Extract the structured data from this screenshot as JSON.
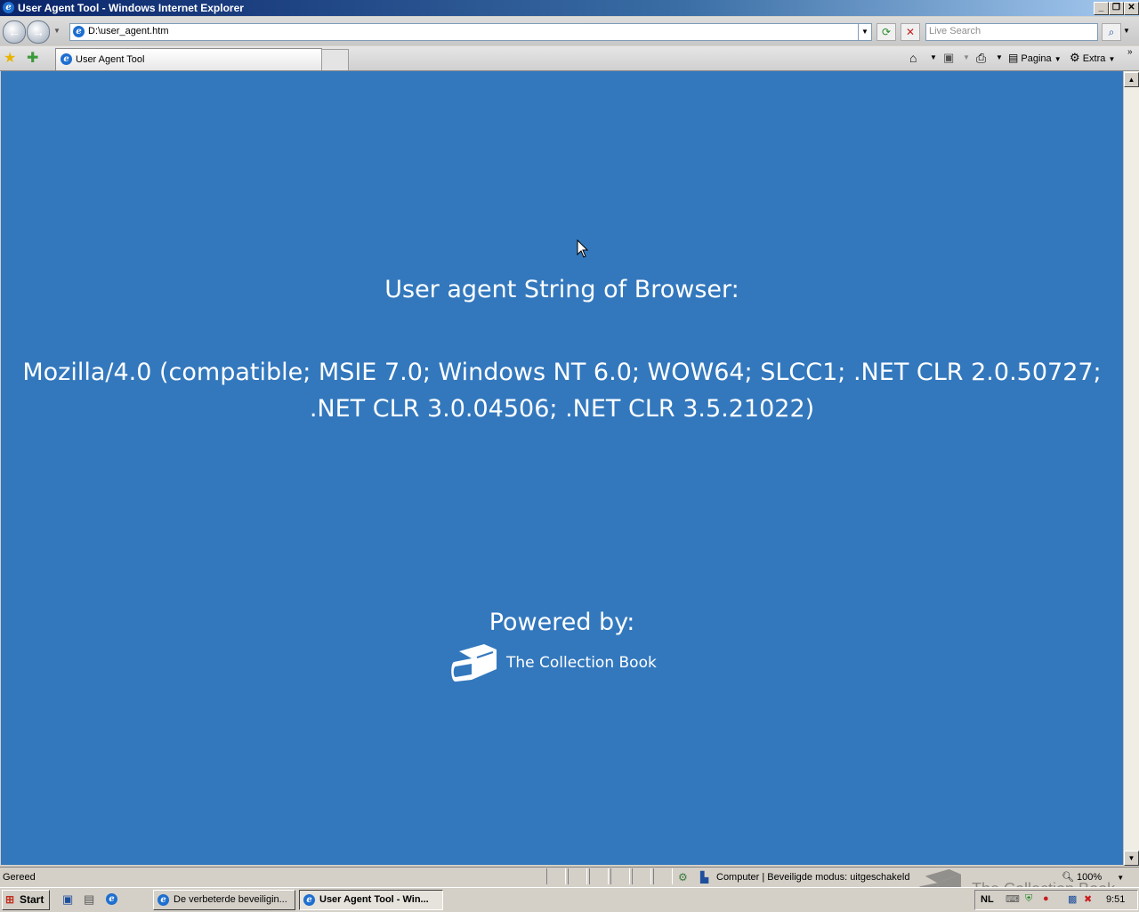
{
  "window": {
    "title": "User Agent Tool - Windows Internet Explorer",
    "minimize": "_",
    "restore": "❐",
    "close": "✕"
  },
  "addressbar": {
    "url": "D:\\user_agent.htm",
    "search_placeholder": "Live Search"
  },
  "tabs": [
    {
      "label": "User Agent Tool"
    }
  ],
  "toolbar": {
    "page_label": "Pagina",
    "tools_label": "Extra"
  },
  "page": {
    "heading": "User agent String of Browser:",
    "user_agent": "Mozilla/4.0 (compatible; MSIE 7.0; Windows NT 6.0; WOW64; SLCC1; .NET CLR 2.0.50727; .NET CLR 3.0.04506; .NET CLR 3.5.21022)",
    "powered_by": "Powered by:",
    "brand": "The Collection Book"
  },
  "statusbar": {
    "status": "Gereed",
    "zone": "Computer | Beveiligde modus: uitgeschakeld",
    "zoom": "100%"
  },
  "taskbar": {
    "start": "Start",
    "buttons": [
      {
        "label": "De verbeterde beveiligin..."
      },
      {
        "label": "User Agent Tool - Win..."
      }
    ],
    "language": "NL",
    "clock": "9:51"
  },
  "watermark": "The Collection Book",
  "colors": {
    "page_background": "#3378bd",
    "page_text": "#ffffff"
  }
}
